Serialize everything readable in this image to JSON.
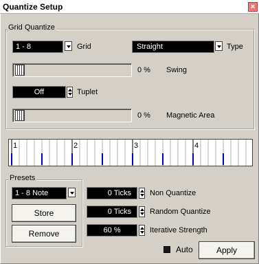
{
  "window": {
    "title": "Quantize Setup"
  },
  "grid_quantize": {
    "group_label": "Grid Quantize",
    "grid_value": "1 - 8",
    "grid_label": "Grid",
    "type_value": "Straight",
    "type_label": "Type",
    "swing_value": "0 %",
    "swing_label": "Swing",
    "tuplet_value": "Off",
    "tuplet_label": "Tuplet",
    "magnetic_value": "0 %",
    "magnetic_label": "Magnetic Area"
  },
  "ruler": {
    "bar_numbers": [
      "1",
      "2",
      "3",
      "4"
    ],
    "grid_subdivisions": 8
  },
  "presets": {
    "group_label": "Presets",
    "selected": "1 - 8 Note",
    "store_label": "Store",
    "remove_label": "Remove"
  },
  "options": {
    "non_quantize_value": "0 Ticks",
    "non_quantize_label": "Non Quantize",
    "random_quantize_value": "0 Ticks",
    "random_quantize_label": "Random Quantize",
    "iterative_value": "60 %",
    "iterative_label": "Iterative Strength"
  },
  "footer": {
    "auto_label": "Auto",
    "auto_checked": true,
    "apply_label": "Apply"
  },
  "colors": {
    "accent": "#0000cc",
    "panel": "#d4d0c8",
    "close": "#e87a7a"
  }
}
